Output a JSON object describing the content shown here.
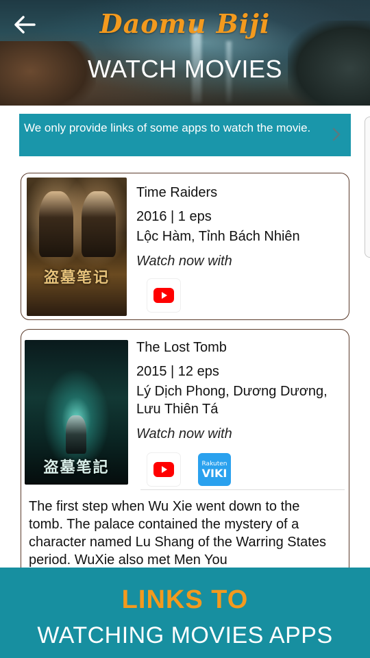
{
  "header": {
    "logo_text": "Daomu Biji",
    "title": "WATCH MOVIES",
    "back_icon": "arrow-left-icon"
  },
  "info_banner": {
    "text": "We only provide links of some apps to watch the movie.",
    "chevron_icon": "chevron-right-icon"
  },
  "movies": [
    {
      "title": "Time Raiders",
      "meta": "2016 | 1 eps",
      "cast": "Lộc Hàm, Tỉnh Bách Nhiên",
      "watch_label": "Watch now with",
      "poster_text": "盗墓笔记",
      "apps": [
        "youtube-icon"
      ]
    },
    {
      "title": "The Lost Tomb",
      "meta": "2015 | 12 eps",
      "cast": "Lý Dịch Phong, Dương Dương, Lưu Thiên Tá",
      "watch_label": "Watch now with",
      "poster_text": "盗墓笔記",
      "apps": [
        "youtube-icon",
        "viki-icon"
      ],
      "viki_small": "Rakuten",
      "viki_big": "VIKI",
      "synopsis": "The first step when Wu Xie went down to the tomb. The palace contained the mystery of a character named Lu Shang of the Warring States period. WuXie also met Men You"
    }
  ],
  "promo": {
    "line1": "LINKS TO",
    "line2": "WATCHING MOVIES APPS"
  },
  "colors": {
    "teal": "#178fa0",
    "banner_teal": "#1a96aa",
    "orange": "#f39a1e",
    "card_border": "#5a3a2a",
    "youtube_red": "#ff0000",
    "viki_blue": "#2aa1ee"
  }
}
